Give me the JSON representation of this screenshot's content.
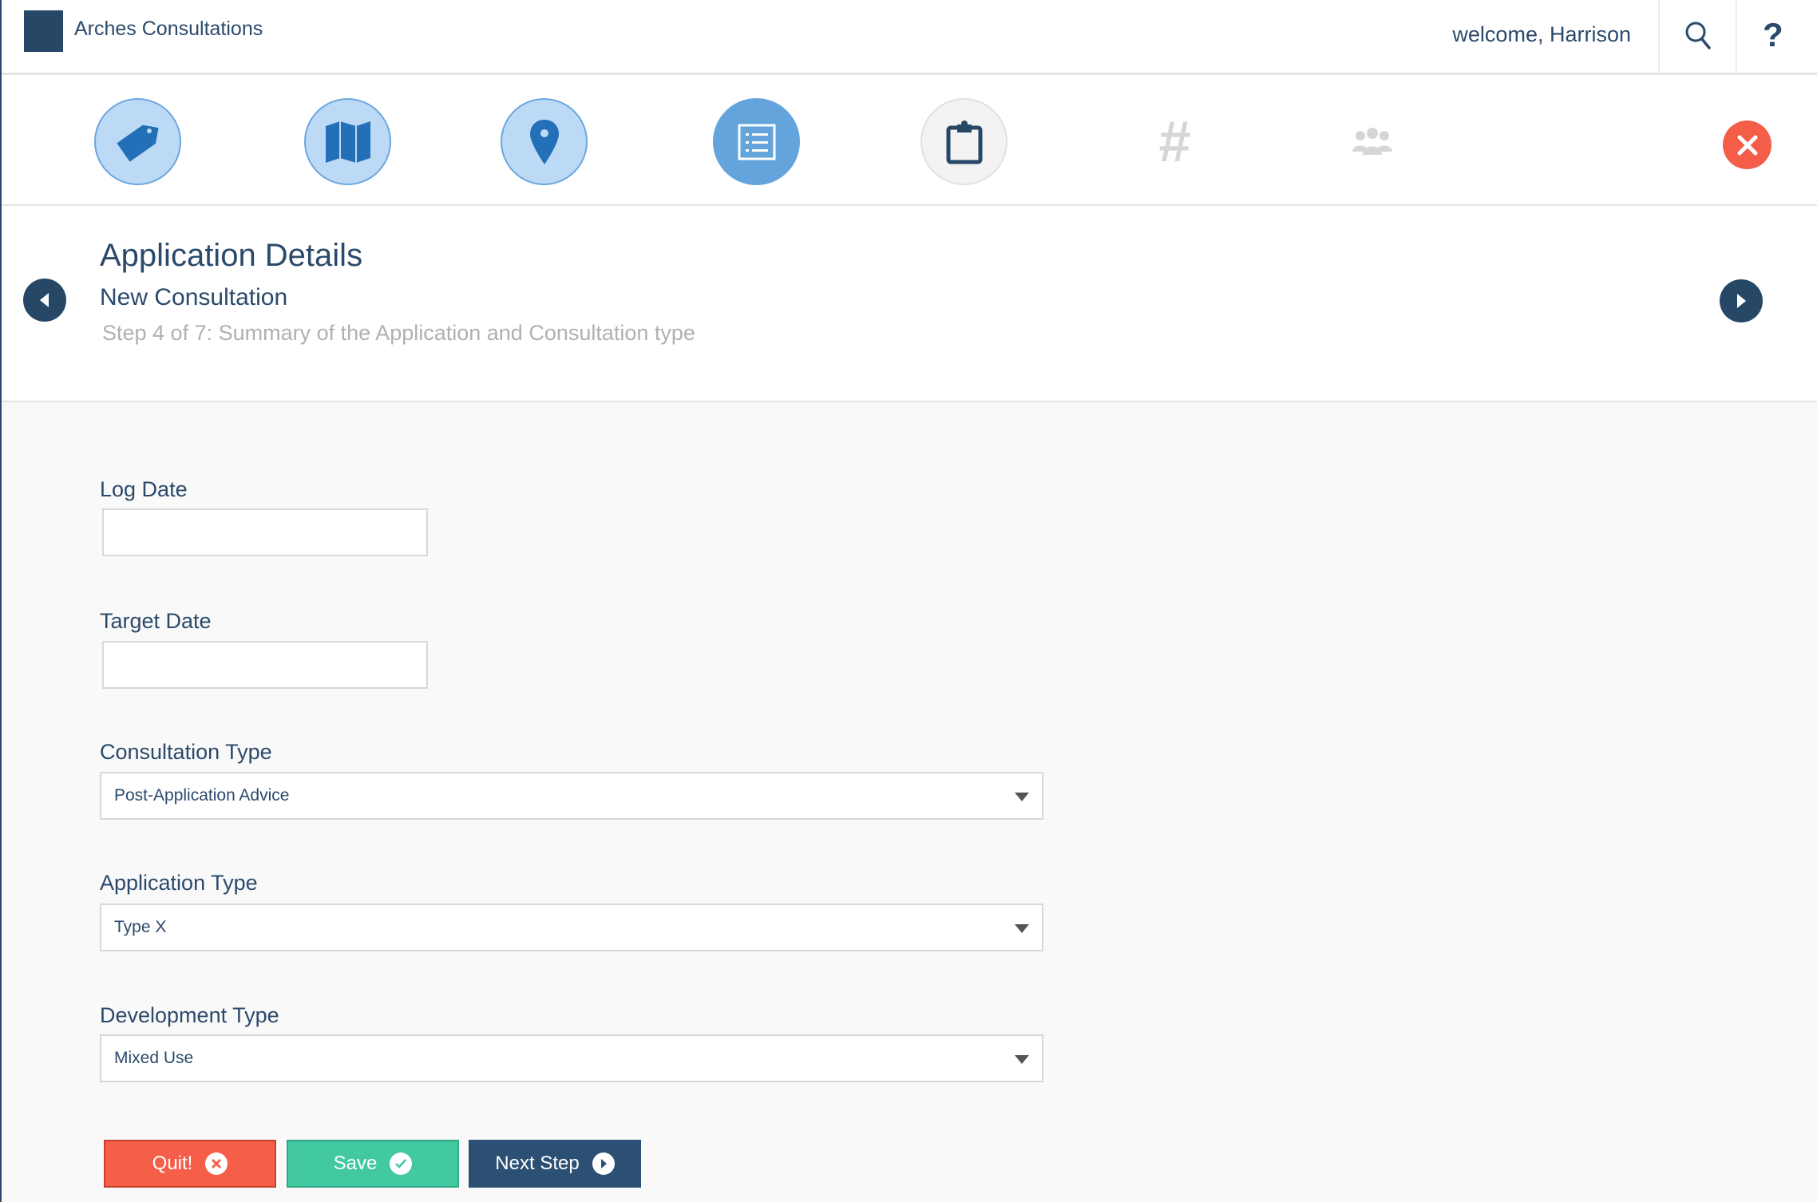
{
  "header": {
    "app_title": "Arches Consultations",
    "welcome": "welcome, Harrison",
    "search_icon": "search-icon",
    "help_label": "?"
  },
  "steps": [
    {
      "icon": "tag-icon",
      "state": "done"
    },
    {
      "icon": "map-icon",
      "state": "done"
    },
    {
      "icon": "map-pin-icon",
      "state": "done"
    },
    {
      "icon": "list-icon",
      "state": "current"
    },
    {
      "icon": "clipboard-icon",
      "state": "todo"
    },
    {
      "icon": "hash-icon",
      "state": "disabled",
      "glyph": "#"
    },
    {
      "icon": "people-icon",
      "state": "disabled"
    }
  ],
  "section": {
    "title": "Application Details",
    "subtitle": "New Consultation",
    "step_text": "Step 4 of 7: Summary of the Application and Consultation type"
  },
  "form": {
    "log_date": {
      "label": "Log Date",
      "value": ""
    },
    "target_date": {
      "label": "Target Date",
      "value": ""
    },
    "consultation_type": {
      "label": "Consultation Type",
      "value": "Post-Application Advice"
    },
    "application_type": {
      "label": "Application Type",
      "value": "Type X"
    },
    "development_type": {
      "label": "Development Type",
      "value": "Mixed Use"
    }
  },
  "buttons": {
    "quit": "Quit!",
    "save": "Save",
    "next": "Next Step"
  },
  "colors": {
    "primary": "#264766",
    "accent": "#64a4dc",
    "quit": "#f55f4a",
    "save": "#42c9a1"
  }
}
